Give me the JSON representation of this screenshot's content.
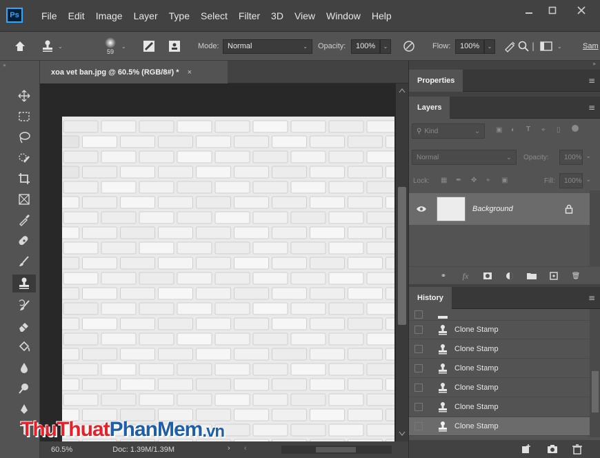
{
  "menubar": {
    "logo": "Ps",
    "items": [
      "File",
      "Edit",
      "Image",
      "Layer",
      "Type",
      "Select",
      "Filter",
      "3D",
      "View",
      "Window",
      "Help"
    ]
  },
  "options": {
    "brush_size": "59",
    "mode_label": "Mode:",
    "mode_value": "Normal",
    "opacity_label": "Opacity:",
    "opacity_value": "100%",
    "flow_label": "Flow:",
    "flow_value": "100%",
    "sample_label": "Sam"
  },
  "document": {
    "tab_title": "xoa vet ban.jpg @ 60.5% (RGB/8#) *",
    "close_glyph": "×"
  },
  "status": {
    "zoom": "60.5%",
    "doc_size": "Doc: 1.39M/1.39M"
  },
  "properties": {
    "tab": "Properties"
  },
  "layers": {
    "tab": "Layers",
    "kind_label": "Kind",
    "blend_mode": "Normal",
    "opacity_label": "Opacity:",
    "opacity_value": "100%",
    "lock_label": "Lock:",
    "fill_label": "Fill:",
    "fill_value": "100%",
    "layer_name": "Background"
  },
  "history": {
    "tab": "History",
    "items": [
      "Clone Stamp",
      "Clone Stamp",
      "Clone Stamp",
      "Clone Stamp",
      "Clone Stamp",
      "Clone Stamp"
    ]
  },
  "watermark": {
    "part1": "Thu",
    "part2": "Thuat",
    "part3": "PhanMem",
    "part4": ".vn"
  },
  "colors": {
    "accent": "#31a8ff",
    "watermark_red": "#e8202a",
    "watermark_blue": "#1f5fa8"
  }
}
